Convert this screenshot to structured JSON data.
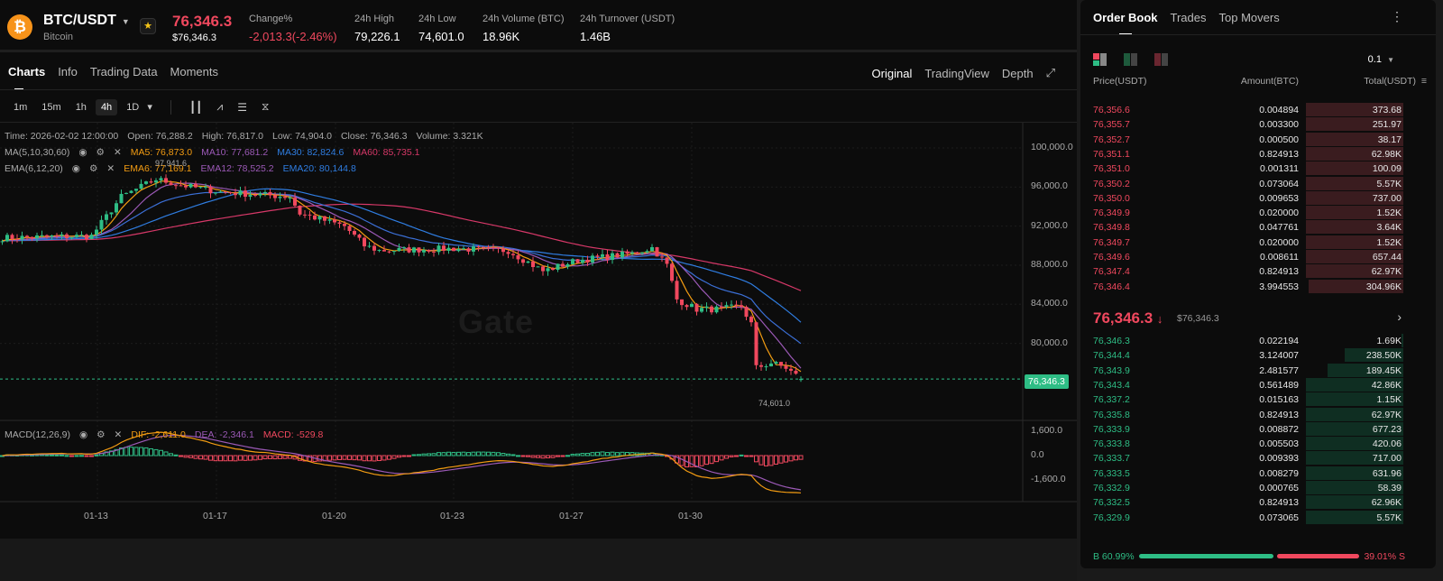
{
  "header": {
    "symbol": "BTC/USDT",
    "name": "Bitcoin",
    "last_price": "76,346.3",
    "last_price_usd": "$76,346.3",
    "stats": [
      {
        "label": "Change%",
        "value": "-2,013.3(-2.46%)",
        "color": "#f0485e"
      },
      {
        "label": "24h High",
        "value": "79,226.1"
      },
      {
        "label": "24h Low",
        "value": "74,601.0"
      },
      {
        "label": "24h Volume (BTC)",
        "value": "18.96K"
      },
      {
        "label": "24h Turnover (USDT)",
        "value": "1.46B"
      }
    ]
  },
  "tabs": [
    "Charts",
    "Info",
    "Trading Data",
    "Moments"
  ],
  "views": [
    "Original",
    "TradingView",
    "Depth"
  ],
  "timeframes": [
    "1m",
    "15m",
    "1h",
    "4h",
    "1D"
  ],
  "active_timeframe": "4h",
  "ohlc": {
    "time": "Time: 2026-02-02 12:00:00",
    "open": "Open: 76,288.2",
    "high": "High: 76,817.0",
    "low": "Low: 74,904.0",
    "close": "Close: 76,346.3",
    "volume": "Volume: 3.321K"
  },
  "ma": {
    "label": "MA(5,10,30,60)",
    "values": [
      {
        "t": "MA5: 76,873.0",
        "c": "#f39c12"
      },
      {
        "t": "MA10: 77,681.2",
        "c": "#9b59b6"
      },
      {
        "t": "MA30: 82,824.6",
        "c": "#2f7de1"
      },
      {
        "t": "MA60: 85,735.1",
        "c": "#d63868"
      }
    ]
  },
  "ema": {
    "label": "EMA(6,12,20)",
    "values": [
      {
        "t": "EMA6: 77,169.1",
        "c": "#f39c12"
      },
      {
        "t": "EMA12: 78,525.2",
        "c": "#9b59b6"
      },
      {
        "t": "EMA20: 80,144.8",
        "c": "#2f7de1"
      }
    ]
  },
  "macd": {
    "label": "MACD(12,26,9)",
    "dif": "DIF: -2,611.0",
    "dea": "DEA: -2,346.1",
    "macd": "MACD: -529.8"
  },
  "watermark": "Gate",
  "chart_data": {
    "type": "candlestick",
    "y_ticks": [
      "100,000.0",
      "96,000.0",
      "92,000.0",
      "88,000.0",
      "84,000.0",
      "80,000.0"
    ],
    "y_tick_values": [
      100000,
      96000,
      92000,
      88000,
      84000,
      80000
    ],
    "macd_ticks": [
      "1,600.0",
      "0.0",
      "-1,600.0"
    ],
    "x_ticks": [
      "01-13",
      "01-17",
      "01-20",
      "01-23",
      "01-27",
      "01-30"
    ],
    "price_tag": "76,346.3",
    "high_marker": "97,941.6",
    "low_marker": "74,601.0",
    "close_path": [
      [
        0,
        90800
      ],
      [
        18,
        91000
      ],
      [
        24,
        95000
      ],
      [
        31,
        96800
      ],
      [
        36,
        96200
      ],
      [
        44,
        95500
      ],
      [
        58,
        95000
      ],
      [
        60,
        93300
      ],
      [
        69,
        92000
      ],
      [
        73,
        90000
      ],
      [
        76,
        89500
      ],
      [
        91,
        89700
      ],
      [
        102,
        89500
      ],
      [
        109,
        87400
      ],
      [
        116,
        88500
      ],
      [
        127,
        89200
      ],
      [
        131,
        89800
      ],
      [
        134,
        88000
      ],
      [
        136,
        84500
      ],
      [
        140,
        83500
      ],
      [
        145,
        83500
      ],
      [
        149,
        83800
      ],
      [
        151,
        82000
      ],
      [
        152,
        77500
      ],
      [
        155,
        78000
      ],
      [
        158,
        77500
      ],
      [
        161,
        76346
      ]
    ]
  },
  "orderbook": {
    "tabs": [
      "Order Book",
      "Trades",
      "Top Movers"
    ],
    "step": "0.1",
    "headers": [
      "Price(USDT)",
      "Amount(BTC)",
      "Total(USDT)"
    ],
    "asks": [
      [
        "76,356.6",
        "0.004894",
        "373.68",
        1
      ],
      [
        "76,355.7",
        "0.003300",
        "251.97",
        1
      ],
      [
        "76,352.7",
        "0.000500",
        "38.17",
        1
      ],
      [
        "76,351.1",
        "0.824913",
        "62.98K",
        1
      ],
      [
        "76,351.0",
        "0.001311",
        "100.09",
        1
      ],
      [
        "76,350.2",
        "0.073064",
        "5.57K",
        1
      ],
      [
        "76,350.0",
        "0.009653",
        "737.00",
        1
      ],
      [
        "76,349.9",
        "0.020000",
        "1.52K",
        1
      ],
      [
        "76,349.8",
        "0.047761",
        "3.64K",
        1
      ],
      [
        "76,349.7",
        "0.020000",
        "1.52K",
        1
      ],
      [
        "76,349.6",
        "0.008611",
        "657.44",
        1
      ],
      [
        "76,347.4",
        "0.824913",
        "62.97K",
        1
      ],
      [
        "76,346.4",
        "3.994553",
        "304.96K",
        0.97
      ]
    ],
    "mid_price": "76,346.3",
    "mid_usd": "$76,346.3",
    "bids": [
      [
        "76,346.3",
        "0.022194",
        "1.69K",
        0.02
      ],
      [
        "76,344.4",
        "3.124007",
        "238.50K",
        0.6
      ],
      [
        "76,343.9",
        "2.481577",
        "189.45K",
        0.78
      ],
      [
        "76,343.4",
        "0.561489",
        "42.86K",
        1
      ],
      [
        "76,337.2",
        "0.015163",
        "1.15K",
        1
      ],
      [
        "76,335.8",
        "0.824913",
        "62.97K",
        1
      ],
      [
        "76,333.9",
        "0.008872",
        "677.23",
        1
      ],
      [
        "76,333.8",
        "0.005503",
        "420.06",
        1
      ],
      [
        "76,333.7",
        "0.009393",
        "717.00",
        1
      ],
      [
        "76,333.5",
        "0.008279",
        "631.96",
        1
      ],
      [
        "76,332.9",
        "0.000765",
        "58.39",
        1
      ],
      [
        "76,332.5",
        "0.824913",
        "62.96K",
        1
      ],
      [
        "76,329.9",
        "0.073065",
        "5.57K",
        1
      ]
    ],
    "buy_ratio": "B 60.99%",
    "sell_ratio": "39.01% S",
    "buy_fraction": 0.6099
  }
}
